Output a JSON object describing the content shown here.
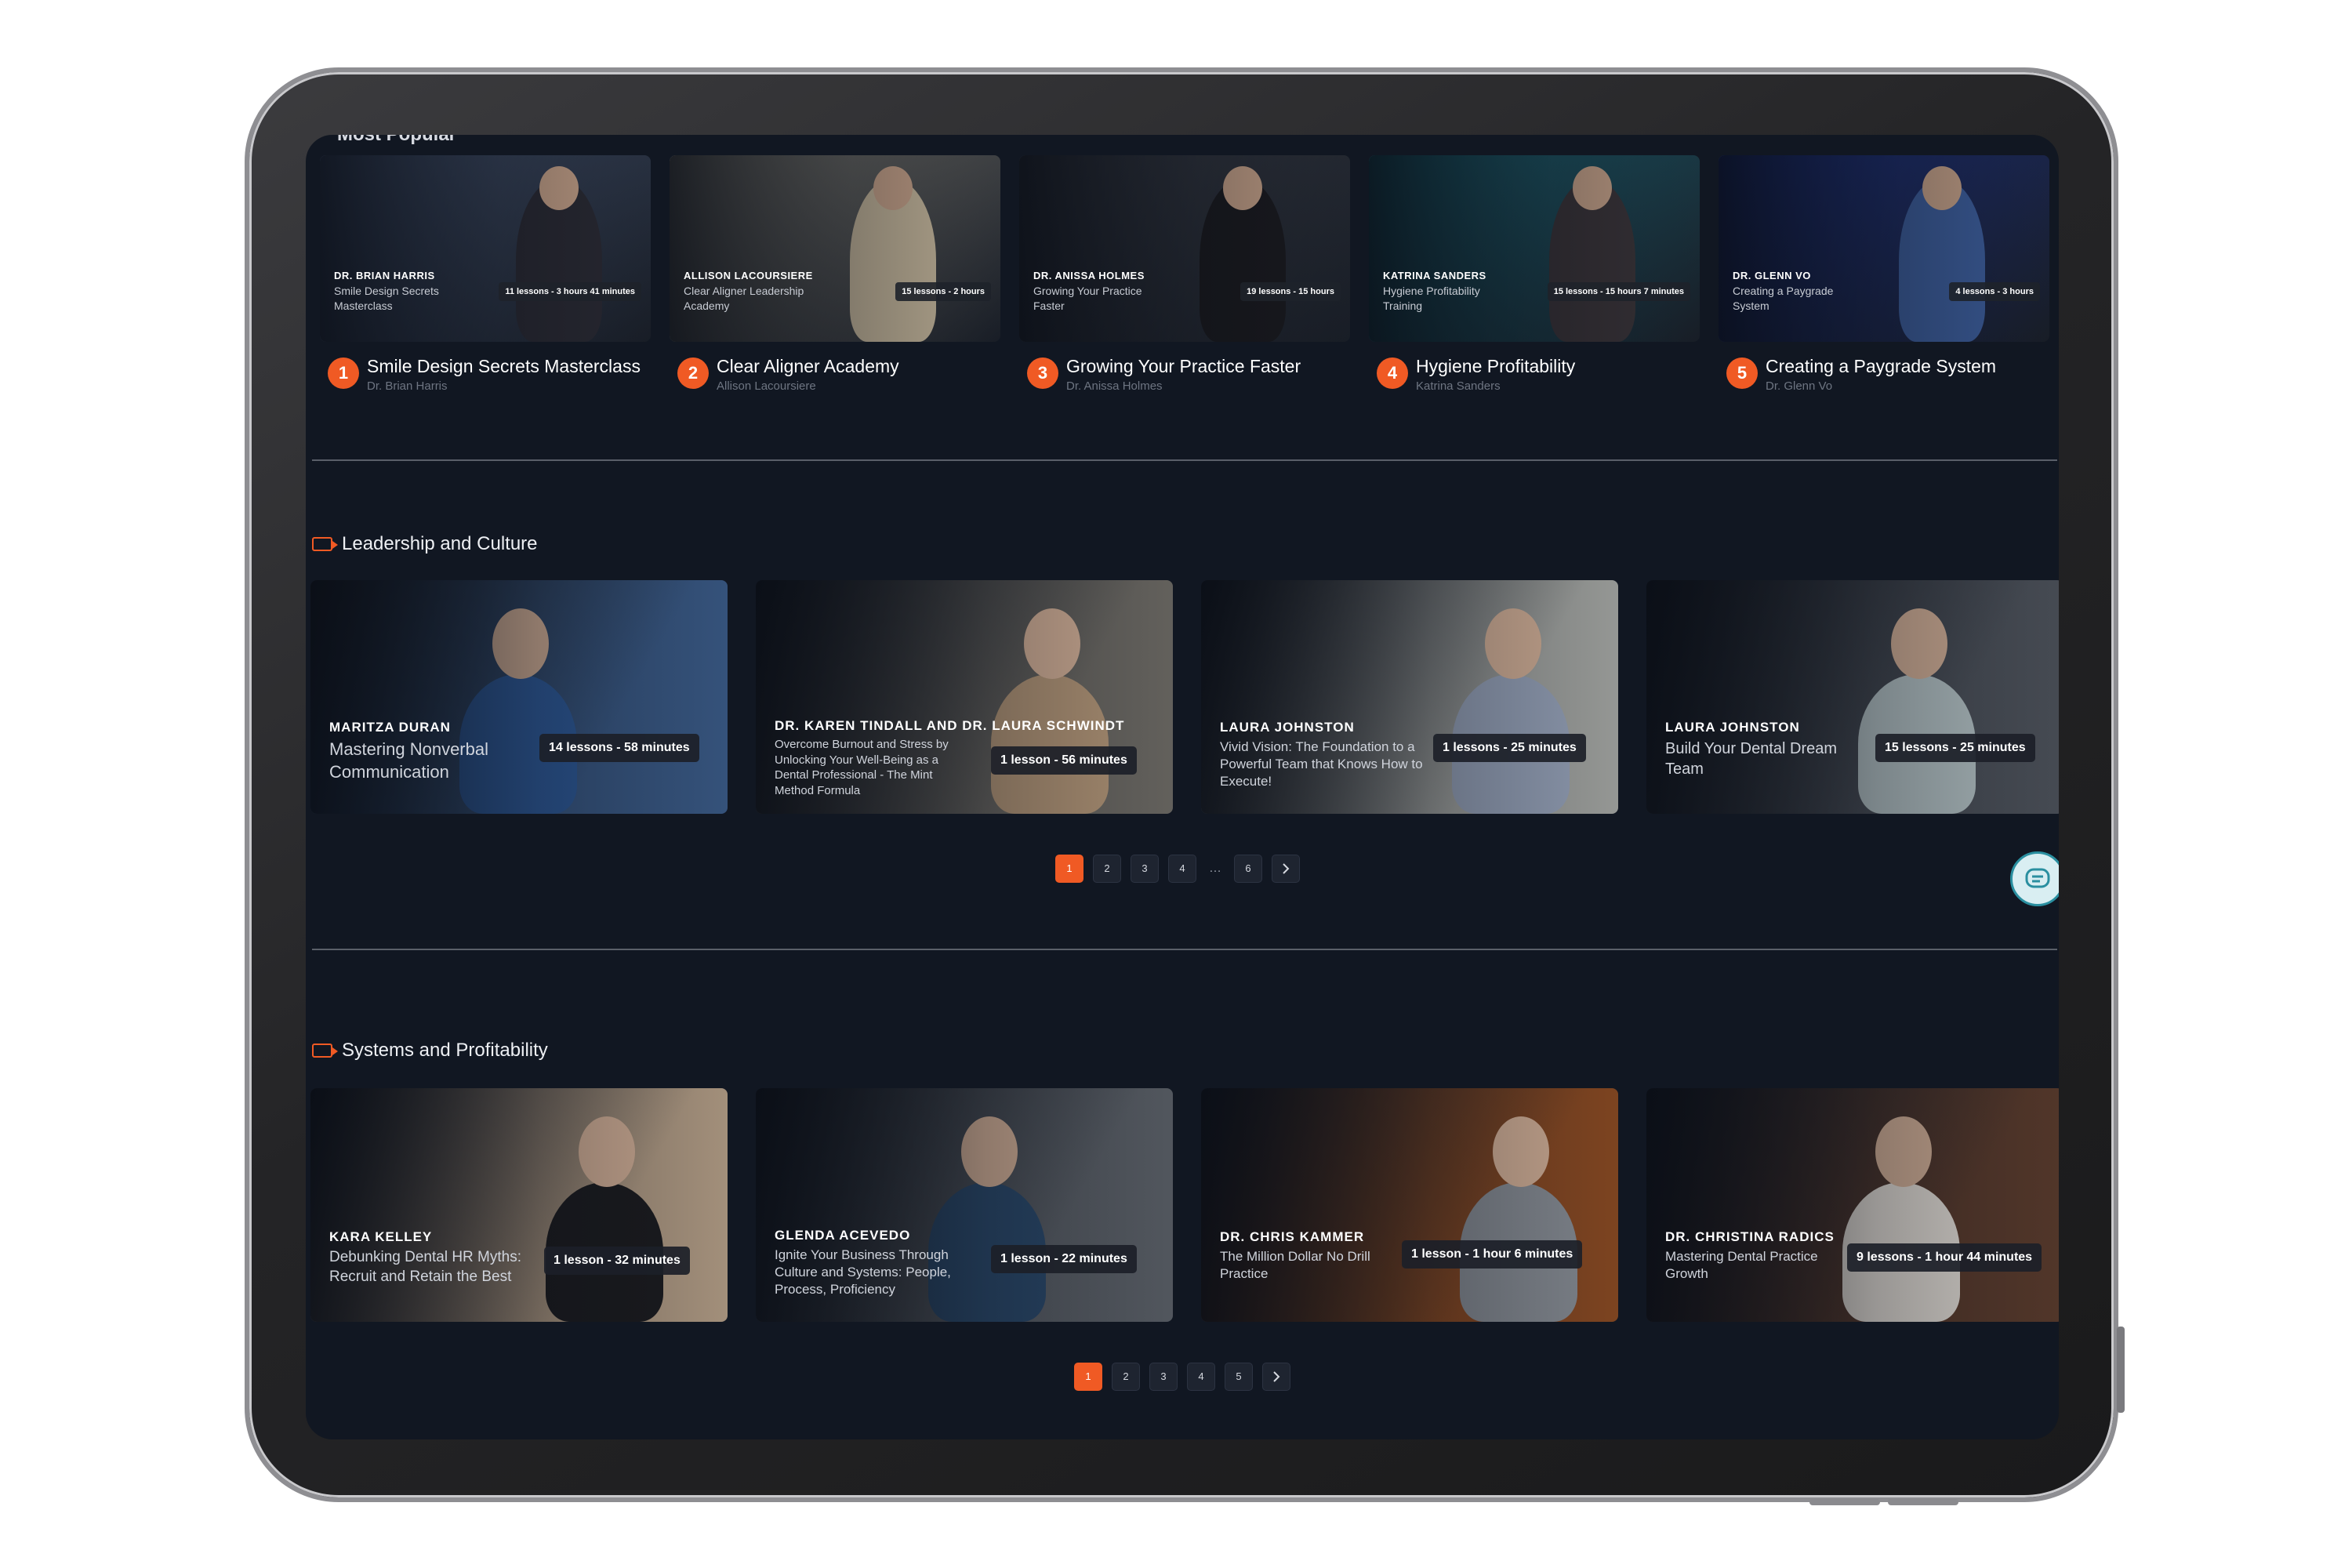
{
  "most_popular": {
    "section_title": "Most Popular",
    "courses": [
      {
        "rank": "1",
        "thumb_name": "DR. BRIAN HARRIS",
        "thumb_sub": "Smile Design Secrets Masterclass",
        "badge": "11 lessons - 3 hours 41 minutes",
        "title": "Smile Design Secrets Masterclass",
        "author": "Dr. Brian Harris",
        "bg": "#4a5a78",
        "person": "#2a2a33"
      },
      {
        "rank": "2",
        "thumb_name": "ALLISON LACOURSIERE",
        "thumb_sub": "Clear Aligner Leadership Academy",
        "badge": "15 lessons - 2 hours",
        "title": "Clear Aligner Academy",
        "author": "Allison Lacoursiere",
        "bg": "#8d8a80",
        "person": "#c7b89c"
      },
      {
        "rank": "3",
        "thumb_name": "DR. ANISSA HOLMES",
        "thumb_sub": "Growing Your Practice Faster",
        "badge": "19 lessons - 15 hours",
        "title": "Growing Your Practice Faster",
        "author": "Dr. Anissa Holmes",
        "bg": "#3b3f48",
        "person": "#1a1a1e"
      },
      {
        "rank": "4",
        "thumb_name": "KATRINA SANDERS",
        "thumb_sub": "Hygiene Profitability Training",
        "badge": "15 lessons - 15 hours 7 minutes",
        "title": "Hygiene Profitability",
        "author": "Katrina Sanders",
        "bg": "#1e6f80",
        "person": "#3a3438"
      },
      {
        "rank": "5",
        "thumb_name": "DR. GLENN VO",
        "thumb_sub": "Creating a Paygrade System",
        "badge": "4 lessons - 3 hours",
        "title": "Creating a Paygrade System",
        "author": "Dr. Glenn Vo",
        "bg": "#1f3590",
        "person": "#3d5e9c"
      }
    ]
  },
  "leadership": {
    "section_title": "Leadership and Culture",
    "cards": [
      {
        "name": "MARITZA DURAN",
        "sub": "Mastering Nonverbal Communication",
        "badge": "14 lessons - 58 minutes",
        "bg": "#3a5a86",
        "person": "#2f5c9c"
      },
      {
        "name": "DR. KAREN TINDALL AND DR. LAURA SCHWINDT",
        "sub": "Overcome Burnout and Stress by Unlocking Your Well-Being as a Dental Professional - The Mint Method Formula",
        "badge": "1 lesson - 56 minutes",
        "bg": "#6d6a64",
        "person": "#b89a7a"
      },
      {
        "name": "LAURA JOHNSTON",
        "sub": "Vivid Vision: The Foundation to a Powerful Team that Knows How to Execute!",
        "badge": "1 lessons - 25 minutes",
        "bg": "#a5a7a3",
        "person": "#9aa6bc"
      },
      {
        "name": "LAURA JOHNSTON",
        "sub": "Build Your Dental Dream Team",
        "badge": "15 lessons - 25 minutes",
        "bg": "#4d525a",
        "person": "#b8c6c8"
      }
    ],
    "pages": [
      "1",
      "2",
      "3",
      "4",
      "…",
      "6"
    ]
  },
  "systems": {
    "section_title": "Systems and Profitability",
    "cards": [
      {
        "name": "KARA KELLEY",
        "sub": "Debunking Dental HR Myths: Recruit and Retain the Best",
        "badge": "1 lesson - 32 minutes",
        "bg": "#b49e86",
        "person": "#1c1c1f"
      },
      {
        "name": "GLENDA ACEVEDO",
        "sub": "Ignite Your Business Through Culture and Systems: People, Process, Proficiency",
        "badge": "1 lesson - 22 minutes",
        "bg": "#5a5f66",
        "person": "#2b4a6c"
      },
      {
        "name": "DR. CHRIS KAMMER",
        "sub": "The Million Dollar No Drill Practice",
        "badge": "1 lesson - 1 hour 6 minutes",
        "bg": "#8a4a22",
        "person": "#8a8f96"
      },
      {
        "name": "DR. CHRISTINA RADICS",
        "sub": "Mastering Dental Practice Growth",
        "badge": "9 lessons - 1 hour 44 minutes",
        "bg": "#5a3b2c",
        "person": "#e6e0d8"
      }
    ],
    "pages": [
      "1",
      "2",
      "3",
      "4",
      "5"
    ]
  },
  "colors": {
    "accent": "#f05a24",
    "screen_bg": "#111722"
  }
}
